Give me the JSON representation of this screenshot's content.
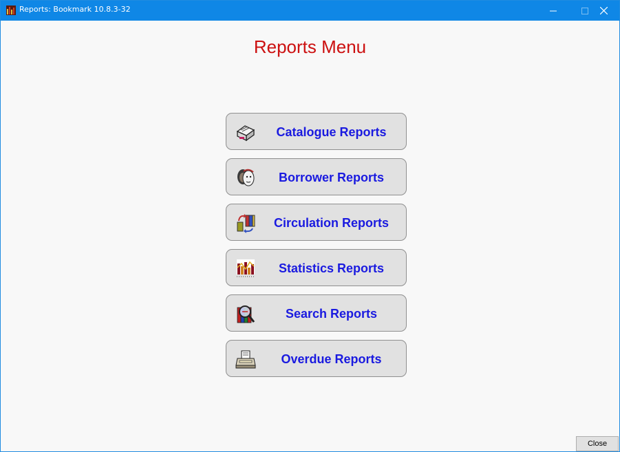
{
  "window": {
    "title": "Reports: Bookmark 10.8.3-32",
    "controls": {
      "minimize": "—",
      "maximize": "□",
      "close": "✕"
    }
  },
  "page": {
    "title": "Reports Menu"
  },
  "menu": {
    "catalogue": {
      "label": "Catalogue Reports",
      "icon": "catalogue-icon"
    },
    "borrower": {
      "label": "Borrower Reports",
      "icon": "borrower-faces-icon"
    },
    "circulation": {
      "label": "Circulation Reports",
      "icon": "circulation-books-icon"
    },
    "statistics": {
      "label": "Statistics Reports",
      "icon": "statistics-chart-icon"
    },
    "search": {
      "label": "Search Reports",
      "icon": "search-magnifier-icon"
    },
    "overdue": {
      "label": "Overdue Reports",
      "icon": "printer-icon"
    }
  },
  "footer": {
    "close_label": "Close"
  },
  "colors": {
    "titlebar": "#0f87e6",
    "page_title": "#cc1010",
    "button_label": "#1a1ae0",
    "button_face": "#e1e1e1"
  }
}
